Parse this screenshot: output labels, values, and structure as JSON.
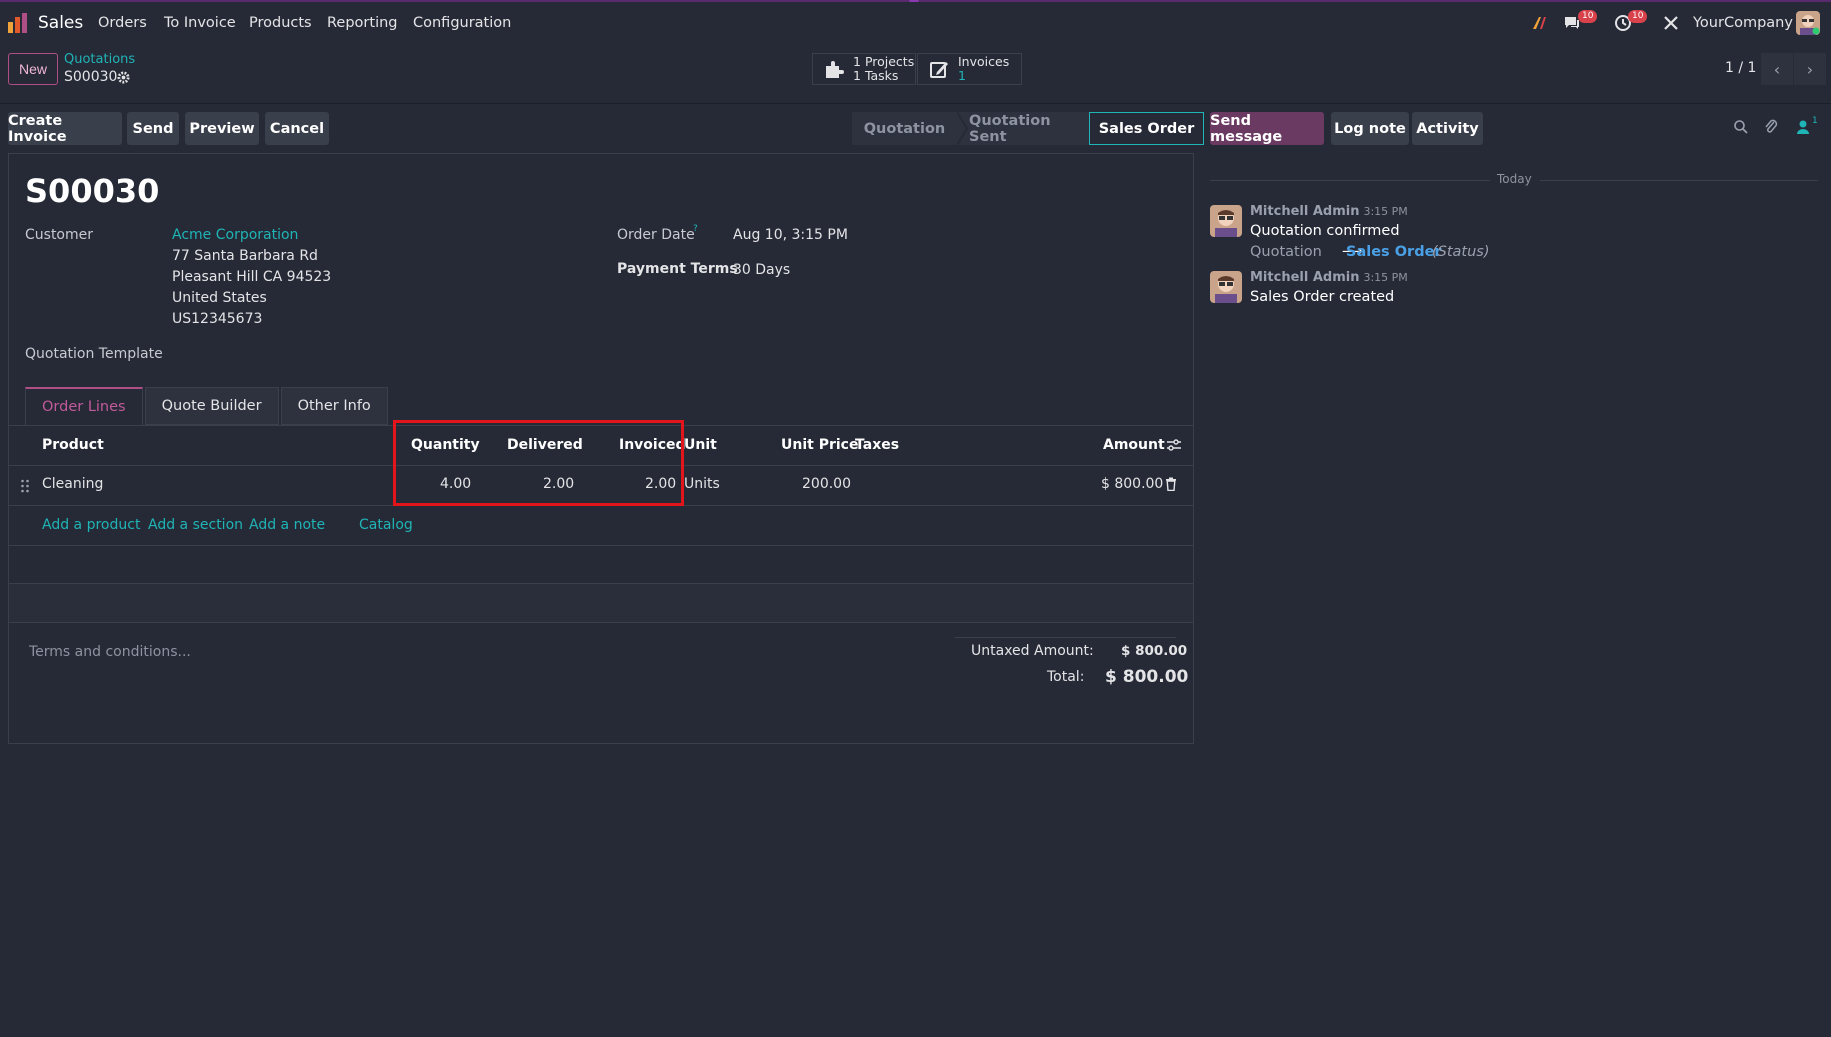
{
  "navbar": {
    "app_name": "Sales",
    "menu": [
      "Orders",
      "To Invoice",
      "Products",
      "Reporting",
      "Configuration"
    ],
    "messages_badge": "10",
    "activities_badge": "10",
    "company": "YourCompany"
  },
  "control_panel": {
    "new_label": "New",
    "breadcrumb_parent": "Quotations",
    "breadcrumb_current": "S00030",
    "smart_projects_count": "1",
    "smart_projects_label": "Projects",
    "smart_tasks_count": "1",
    "smart_tasks_label": "Tasks",
    "smart_invoices_label": "Invoices",
    "smart_invoices_count": "1",
    "pager": "1 / 1"
  },
  "actions": {
    "create_invoice": "Create Invoice",
    "send": "Send",
    "preview": "Preview",
    "cancel": "Cancel"
  },
  "status": {
    "steps": [
      "Quotation",
      "Quotation Sent",
      "Sales Order"
    ],
    "active": "Sales Order"
  },
  "form": {
    "title": "S00030",
    "customer_label": "Customer",
    "customer_name": "Acme Corporation",
    "address_line1": "77 Santa Barbara Rd",
    "address_line2": "Pleasant Hill CA 94523",
    "address_line3": "United States",
    "address_line4": "US12345673",
    "order_date_label": "Order Date",
    "order_date_help": "?",
    "order_date": "Aug 10, 3:15 PM",
    "payment_terms_label": "Payment Terms",
    "payment_terms": "30 Days",
    "quotation_template_label": "Quotation Template",
    "tabs": [
      "Order Lines",
      "Quote Builder",
      "Other Info"
    ]
  },
  "order_lines": {
    "headers": {
      "product": "Product",
      "quantity": "Quantity",
      "delivered": "Delivered",
      "invoiced": "Invoiced",
      "unit": "Unit",
      "unit_price": "Unit Price",
      "taxes": "Taxes",
      "amount": "Amount"
    },
    "rows": [
      {
        "product": "Cleaning",
        "quantity": "4.00",
        "delivered": "2.00",
        "invoiced": "2.00",
        "unit": "Units",
        "unit_price": "200.00",
        "taxes": "",
        "amount": "$ 800.00"
      }
    ],
    "add_product": "Add a product",
    "add_section": "Add a section",
    "add_note": "Add a note",
    "catalog": "Catalog"
  },
  "totals": {
    "terms_placeholder": "Terms and conditions...",
    "untaxed_label": "Untaxed Amount:",
    "untaxed_value": "$ 800.00",
    "total_label": "Total:",
    "total_value": "$ 800.00"
  },
  "chatter": {
    "send_message": "Send message",
    "log_note": "Log note",
    "activity": "Activity",
    "followers_count": "1",
    "date_separator": "Today",
    "messages": [
      {
        "author": "Mitchell Admin",
        "time": "3:15 PM",
        "body": "Quotation confirmed",
        "tracking_old": "Quotation",
        "tracking_arrow": "⟶",
        "tracking_new": "Sales Order",
        "tracking_field": "(Status)"
      },
      {
        "author": "Mitchell Admin",
        "time": "3:15 PM",
        "body": "Sales Order created"
      }
    ]
  },
  "colors": {
    "background": "#262a36",
    "link": "#1fb4b6",
    "primary": "#b04e86",
    "highlight_box": "#e3141a"
  }
}
